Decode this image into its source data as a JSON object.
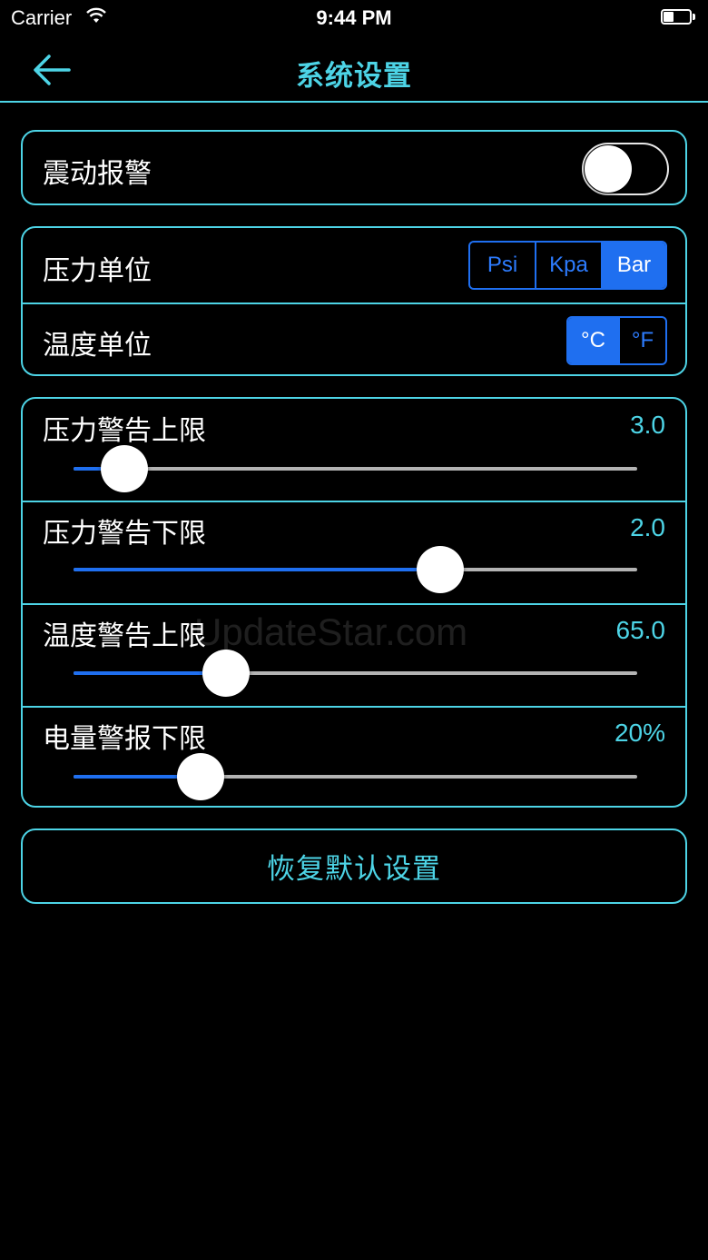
{
  "status_bar": {
    "carrier": "Carrier",
    "time": "9:44 PM",
    "battery_level": 0.4,
    "icons": [
      "wifi-icon",
      "battery-icon"
    ]
  },
  "nav": {
    "title": "系统设置",
    "back_icon": "arrow-left-icon",
    "accent_color": "#4dd4e6"
  },
  "vibration_alarm": {
    "label": "震动报警",
    "enabled": false
  },
  "units": {
    "pressure": {
      "label": "压力单位",
      "options": [
        "Psi",
        "Kpa",
        "Bar"
      ],
      "selected": "Bar"
    },
    "temperature": {
      "label": "温度单位",
      "options": [
        "°C",
        "°F"
      ],
      "selected": "°C"
    }
  },
  "sliders": [
    {
      "label": "压力警告上限",
      "value": "3.0",
      "fraction": 0.09
    },
    {
      "label": "压力警告下限",
      "value": "2.0",
      "fraction": 0.65
    },
    {
      "label": "温度警告上限",
      "value": "65.0",
      "fraction": 0.27
    },
    {
      "label": "电量警报下限",
      "value": "20%",
      "fraction": 0.225
    }
  ],
  "reset_button": {
    "label": "恢复默认设置"
  },
  "watermark": "UpdateStar.com",
  "colors": {
    "accent": "#4dd4e6",
    "selected_blue": "#1f6ff0",
    "background": "#000000"
  }
}
